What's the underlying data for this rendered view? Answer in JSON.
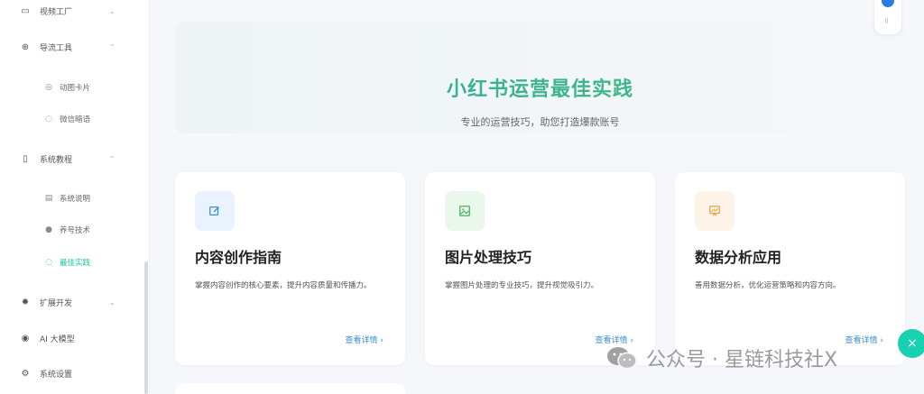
{
  "sidebar": {
    "items": [
      {
        "icon": "video-icon",
        "glyph": "▭",
        "label": "视频工厂",
        "chevron": "⌄"
      },
      {
        "icon": "link-icon",
        "glyph": "⊕",
        "label": "导流工具",
        "chevron": "⌃"
      },
      {
        "icon": "card-icon",
        "glyph": "◎",
        "label": "动图卡片"
      },
      {
        "icon": "chat-icon",
        "glyph": "◌",
        "label": "微信暗语"
      },
      {
        "icon": "book-icon",
        "glyph": "▯",
        "label": "系统教程",
        "chevron": "⌃"
      },
      {
        "icon": "doc-icon",
        "glyph": "▤",
        "label": "系统说明"
      },
      {
        "icon": "user-icon",
        "glyph": "●",
        "label": "养号技术"
      },
      {
        "icon": "target-icon",
        "glyph": "◌",
        "label": "最佳实践"
      },
      {
        "icon": "gear-icon",
        "glyph": "✹",
        "label": "扩展开发",
        "chevron": "⌄"
      },
      {
        "icon": "ai-icon",
        "glyph": "◉",
        "label": "AI 大模型"
      },
      {
        "icon": "settings-icon",
        "glyph": "⚙",
        "label": "系统设置"
      }
    ]
  },
  "hero": {
    "title": "小红书运营最佳实践",
    "subtitle": "专业的运营技巧，助您打造爆款账号"
  },
  "cards": [
    {
      "title": "内容创作指南",
      "desc": "掌握内容创作的核心要素，提升内容质量和传播力。",
      "link": "查看详情 ›",
      "icon": "edit-icon",
      "icon_bg": "#eaf3fd",
      "icon_color": "#3a8fd6"
    },
    {
      "title": "图片处理技巧",
      "desc": "掌握图片处理的专业技巧，提升视觉吸引力。",
      "link": "查看详情 ›",
      "icon": "image-icon",
      "icon_bg": "#eaf7ec",
      "icon_color": "#45b35a"
    },
    {
      "title": "数据分析应用",
      "desc": "善用数据分析，优化运营策略和内容方向。",
      "link": "查看详情 ›",
      "icon": "chart-board-icon",
      "icon_bg": "#fdf3e7",
      "icon_color": "#e8a24a"
    }
  ],
  "watermark": {
    "text": "公众号 · 星链科技社X"
  },
  "close_fab": {
    "glyph": "×"
  },
  "float_widget": {
    "drag_glyph": "⠿"
  }
}
